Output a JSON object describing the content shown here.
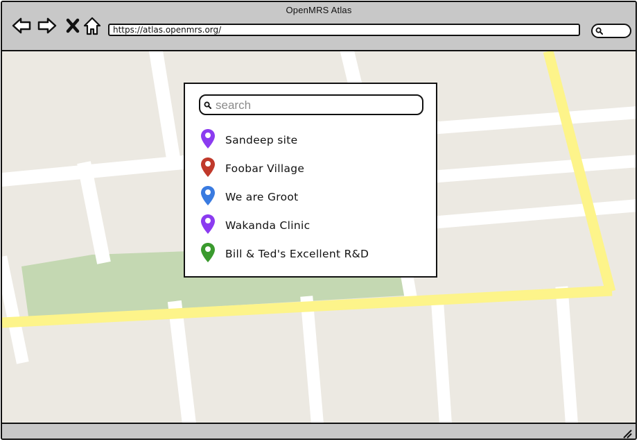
{
  "window": {
    "title": "OpenMRS Atlas"
  },
  "toolbar": {
    "back_icon": "back-arrow-icon",
    "forward_icon": "forward-arrow-icon",
    "stop_icon": "close-x-icon",
    "home_icon": "home-icon",
    "url": "https://atlas.openmrs.org/",
    "search_icon": "search-icon"
  },
  "panel": {
    "search_placeholder": "search",
    "sites": [
      {
        "label": "Sandeep site",
        "pin_color": "#8b3bf0"
      },
      {
        "label": "Foobar Village",
        "pin_color": "#c0392b"
      },
      {
        "label": "We are Groot",
        "pin_color": "#3a7be0"
      },
      {
        "label": "Wakanda Clinic",
        "pin_color": "#8b3bf0"
      },
      {
        "label": "Bill & Ted's Excellent R&D",
        "pin_color": "#3a9a2e"
      }
    ]
  },
  "colors": {
    "map_background": "#ece9e2",
    "road_white": "#ffffff",
    "road_major": "#fdf48a",
    "park": "#c4d8b2",
    "chrome": "#c8c8c8"
  }
}
